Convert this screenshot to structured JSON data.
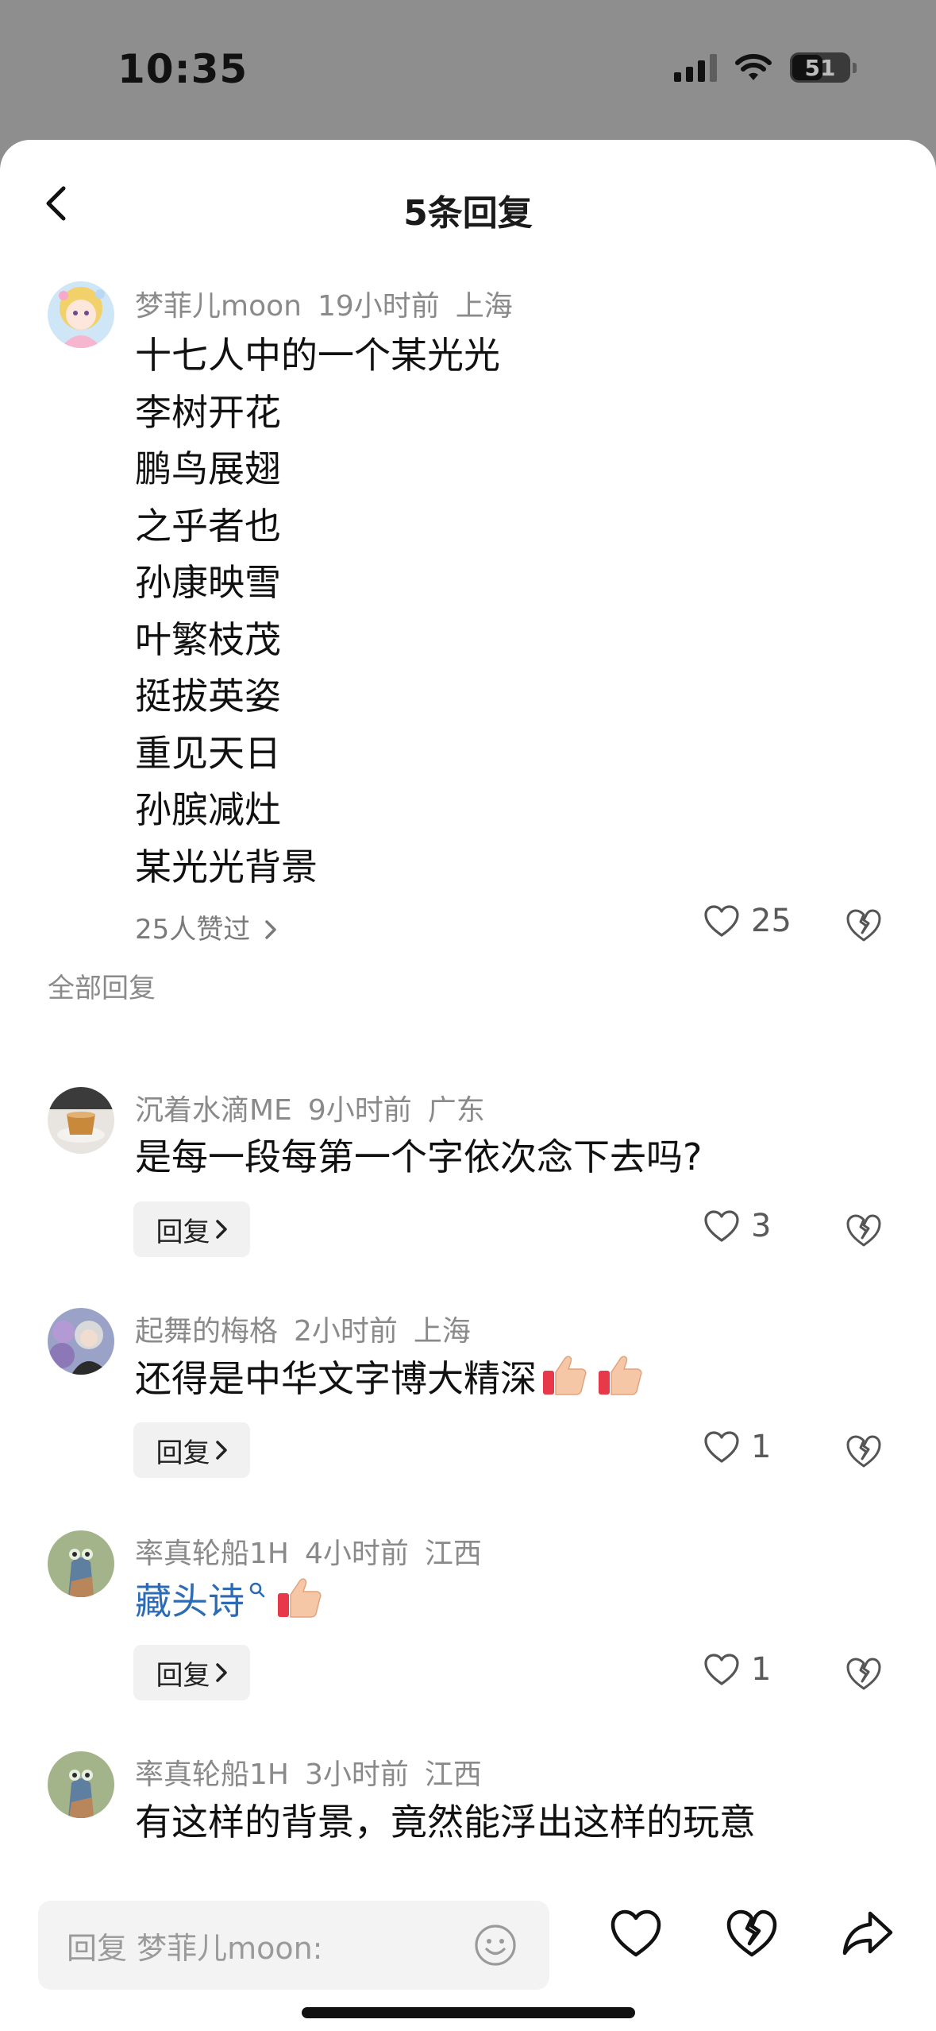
{
  "status_bar": {
    "time": "10:35",
    "battery": "51"
  },
  "header": {
    "title": "5条回复"
  },
  "main_comment": {
    "user": "梦菲儿moon",
    "time": "19小时前",
    "location": "上海",
    "lines": [
      "十七人中的一个某光光",
      "李树开花",
      "鹏鸟展翅",
      "之乎者也",
      "孙康映雪",
      "叶繁枝茂",
      "挺拔英姿",
      "重见天日",
      "孙膑减灶",
      "某光光背景"
    ],
    "liked_by": "25人赞过",
    "likes": "25"
  },
  "section_label": "全部回复",
  "replies": [
    {
      "user": "沉着水滴ME",
      "time": "9小时前",
      "location": "广东",
      "text": "是每一段每第一个字依次念下去吗?",
      "likes": "3",
      "reply_label": "回复"
    },
    {
      "user": "起舞的梅格",
      "time": "2小时前",
      "location": "上海",
      "text": "还得是中华文字博大精深",
      "likes": "1",
      "reply_label": "回复"
    },
    {
      "user": "率真轮船1H",
      "time": "4小时前",
      "location": "江西",
      "text": "藏头诗",
      "likes": "1",
      "reply_label": "回复"
    },
    {
      "user": "率真轮船1H",
      "time": "3小时前",
      "location": "江西",
      "text": "有这样的背景，竟然能浮出这样的玩意"
    }
  ],
  "bottom_bar": {
    "input_placeholder": "回复 梦菲儿moon:"
  },
  "colors": {
    "link": "#2d6cb5",
    "meta": "#8a8a8a",
    "accent_thumb": "#e8394a"
  }
}
